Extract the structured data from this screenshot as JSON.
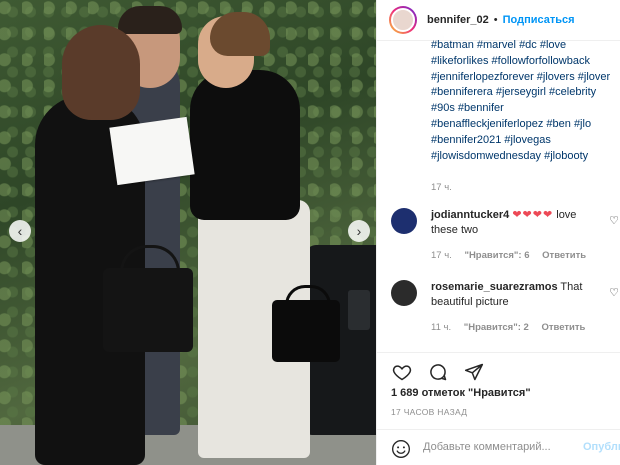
{
  "header": {
    "username": "bennifer_02",
    "separator": "•",
    "follow_label": "Подписаться"
  },
  "caption": {
    "hashtags": [
      "#batman",
      "#marvel",
      "#dc",
      "#love",
      "#likeforlikes",
      "#followforfollowback",
      "#jenniferlopezforever",
      "#jlovers",
      "#jlover",
      "#benniferera",
      "#jerseygirl",
      "#celebrity",
      "#90s",
      "#bennifer",
      "#benaffleckjeniferlopez",
      "#ben",
      "#jlo",
      "#bennifer2021",
      "#jlovegas",
      "#jlowisdomwednesday",
      "#jlobooty"
    ],
    "time": "17 ч."
  },
  "comments": [
    {
      "username": "jodianntucker4",
      "hearts": "❤❤❤❤",
      "text": " love these two",
      "time": "17 ч.",
      "likes": "\"Нравится\": 6",
      "reply": "Ответить",
      "avatar_color": "#1d2f6f"
    },
    {
      "username": "rosemarie_suarezramos",
      "hearts": "",
      "text": " That beautiful picture",
      "time": "11 ч.",
      "likes": "\"Нравится\": 2",
      "reply": "Ответить",
      "avatar_color": "#2b2b2b"
    }
  ],
  "actions": {
    "likes": "1 689 отметок \"Нравится\"",
    "ago": "17 ЧАСОВ НАЗАД"
  },
  "add_comment": {
    "placeholder": "Добавьте комментарий...",
    "publish_label": "Опубликовать"
  },
  "icons": {
    "like": "heart-icon",
    "comment": "comment-icon",
    "share": "send-icon",
    "emoji": "emoji-icon",
    "prev": "chevron-left-icon",
    "next": "chevron-right-icon"
  },
  "colors": {
    "link": "#00376b",
    "accent": "#0095f6",
    "heart": "#ed4956",
    "muted": "#8e8e8e"
  }
}
